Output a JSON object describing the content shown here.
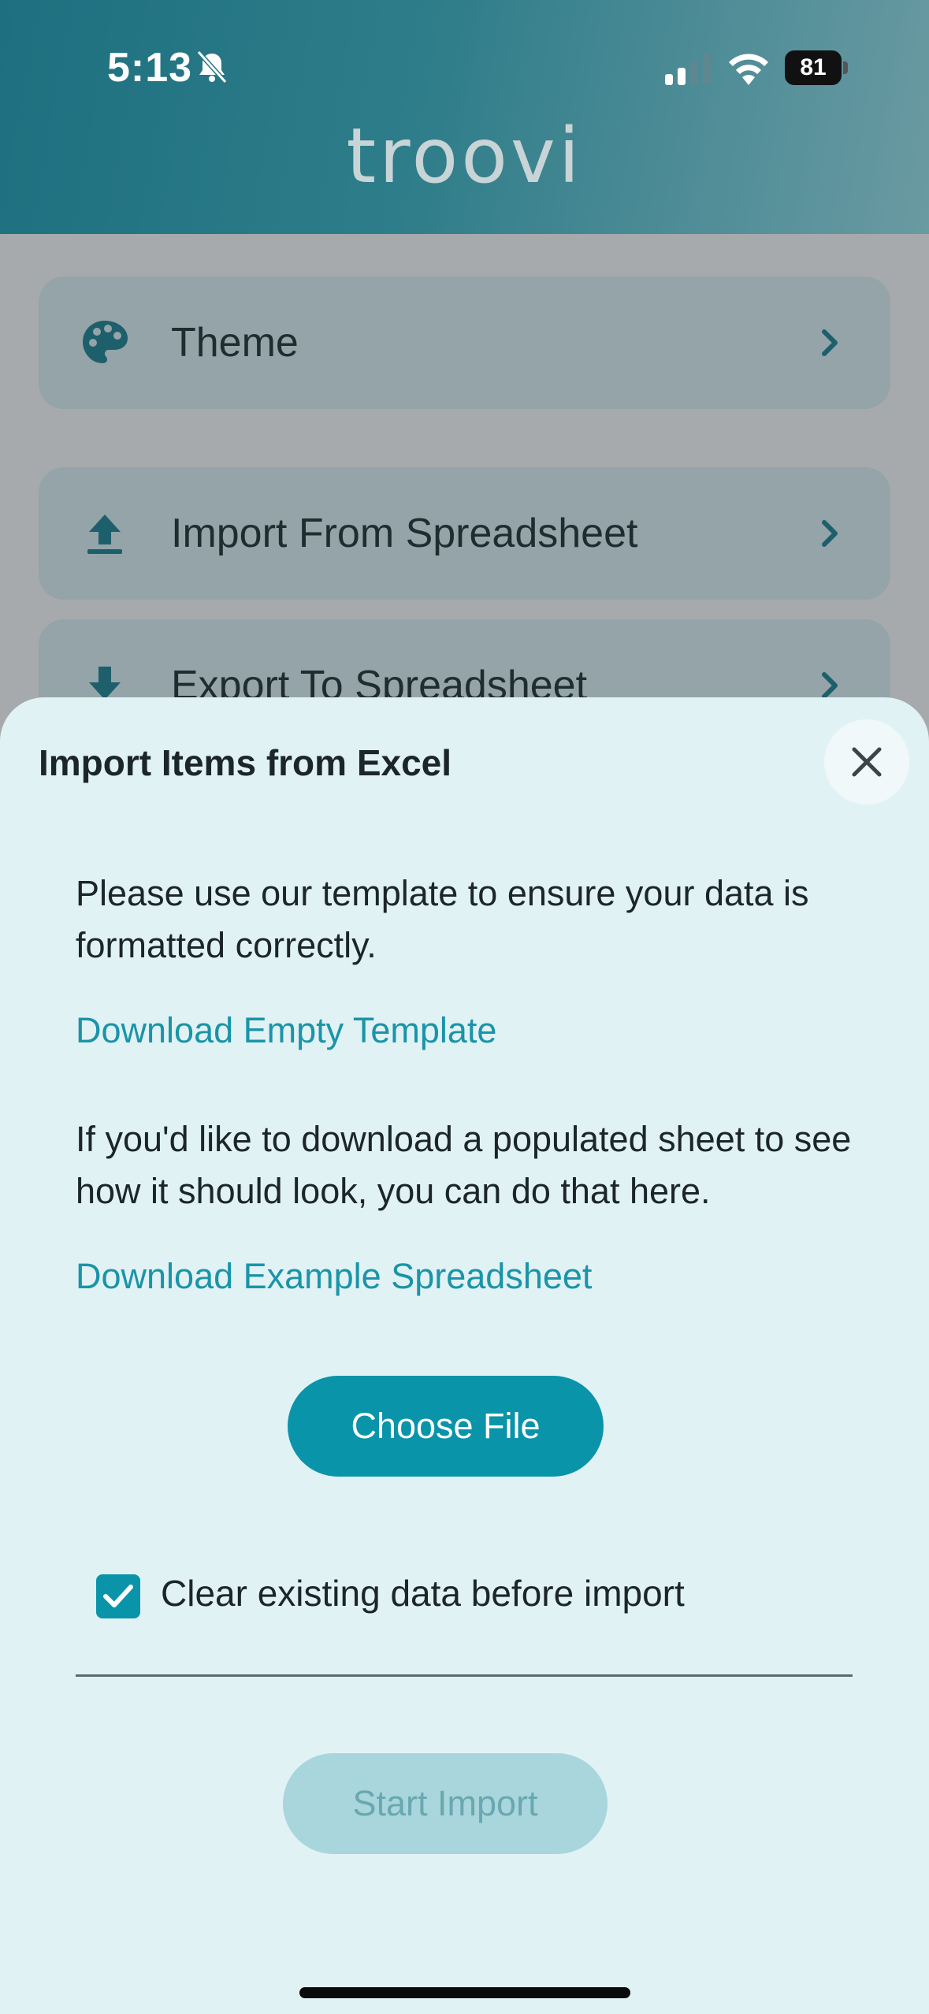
{
  "status_bar": {
    "time": "5:13",
    "battery": "81",
    "icons": [
      "bell-slash-icon",
      "signal-icon",
      "wifi-icon",
      "battery-icon"
    ]
  },
  "header": {
    "logo": "troovi"
  },
  "menu": {
    "items": [
      {
        "label": "Theme",
        "icon": "palette-icon"
      },
      {
        "label": "Import From Spreadsheet",
        "icon": "upload-icon"
      },
      {
        "label": "Export To Spreadsheet",
        "icon": "download-icon"
      }
    ]
  },
  "sheet": {
    "title": "Import Items from Excel",
    "intro": "Please use our template to ensure your data is formatted correctly.",
    "empty_template_link": "Download Empty Template",
    "example_text": "If you'd like to download a populated sheet to see how it should look, you can do that here.",
    "example_link": "Download Example Spreadsheet",
    "choose_file": "Choose File",
    "clear_checkbox_label": "Clear existing data before import",
    "clear_checked": true,
    "start_import": "Start Import"
  },
  "colors": {
    "accent": "#0a94aa",
    "link": "#1a94a8",
    "sheet_bg": "#e1f2f5",
    "disabled_button": "#a8d6dc"
  }
}
